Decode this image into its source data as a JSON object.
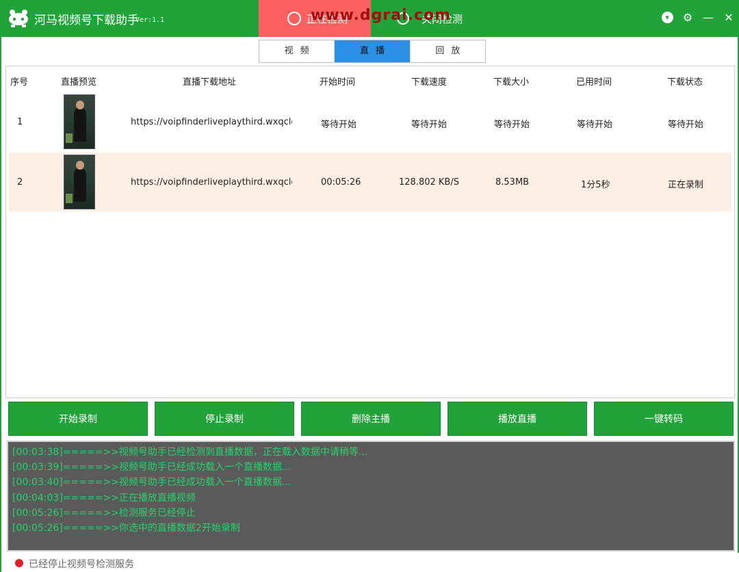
{
  "colors": {
    "primary_green": "#22a339",
    "active_red": "#fb6161",
    "tab_blue": "#2c90e6",
    "row_highlight": "#fdefe3",
    "log_bg": "#5a5a5a",
    "log_text": "#23d46a",
    "status_dot": "#e0202c"
  },
  "app": {
    "title": "河马视频号下载助手",
    "version": "Ver:1.1",
    "watermark": "www.dgrai.com",
    "icons": {
      "logo": "car-logo-icon",
      "minimize": "minimize-icon",
      "close": "close-icon",
      "settings": "gear-icon",
      "download": "download-circle-icon"
    }
  },
  "detect_tabs": [
    {
      "label": "正在检测",
      "icon": "detect-icon",
      "active": true
    },
    {
      "label": "关闭检测",
      "icon": "stop-detect-icon",
      "active": false
    }
  ],
  "mode_tabs": [
    {
      "label": "视频",
      "active": false
    },
    {
      "label": "直播",
      "active": true
    },
    {
      "label": "回放",
      "active": false
    }
  ],
  "table": {
    "headers": [
      "序号",
      "直播预览",
      "直播下载地址",
      "开始时间",
      "下载速度",
      "下载大小",
      "已用时间",
      "下载状态"
    ],
    "rows": [
      {
        "index": "1",
        "url": "https://voipfinderliveplaythird.wxqclo",
        "start_time": "等待开始",
        "speed": "等待开始",
        "size": "等待开始",
        "elapsed": "等待开始",
        "status": "等待开始",
        "selected": false
      },
      {
        "index": "2",
        "url": "https://voipfinderliveplaythird.wxqclo",
        "start_time": "00:05:26",
        "speed": "128.802 KB/S",
        "size": "8.53MB",
        "elapsed": "1分5秒",
        "status": "正在录制",
        "selected": true
      }
    ]
  },
  "actions": [
    "开始录制",
    "停止录制",
    "删除主播",
    "播放直播",
    "一键转码"
  ],
  "log": [
    "[00:03:38]=====>>视频号助手已经检测到直播数据，正在载入数据中请稍等...",
    "[00:03:39]=====>>视频号助手已经成功载入一个直播数据...",
    "[00:03:40]=====>>视频号助手已经成功载入一个直播数据...",
    "[00:04:03]=====>>正在播放直播视频",
    "[00:05:26]=====>>检测服务已经停止",
    "[00:05:26]=====>>你选中的直播数据2开始录制"
  ],
  "status": {
    "text": "已经停止视频号检测服务"
  }
}
